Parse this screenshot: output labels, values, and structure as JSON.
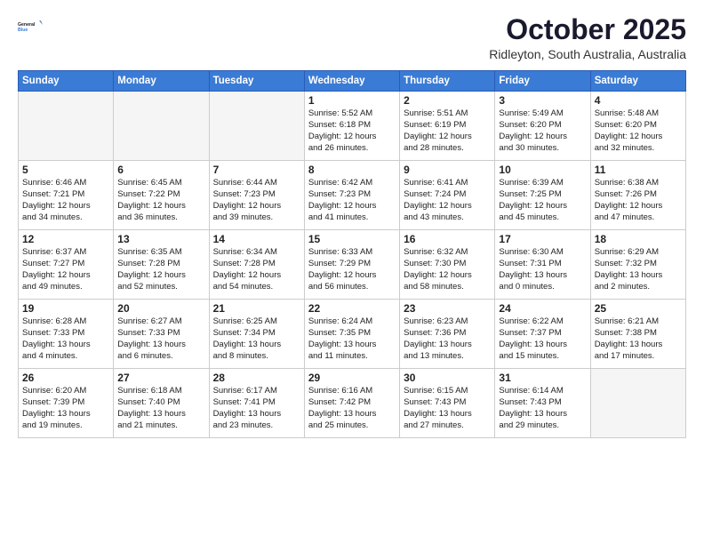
{
  "header": {
    "logo_line1": "General",
    "logo_line2": "Blue",
    "month": "October 2025",
    "location": "Ridleyton, South Australia, Australia"
  },
  "weekdays": [
    "Sunday",
    "Monday",
    "Tuesday",
    "Wednesday",
    "Thursday",
    "Friday",
    "Saturday"
  ],
  "weeks": [
    [
      {
        "day": "",
        "info": ""
      },
      {
        "day": "",
        "info": ""
      },
      {
        "day": "",
        "info": ""
      },
      {
        "day": "1",
        "info": "Sunrise: 5:52 AM\nSunset: 6:18 PM\nDaylight: 12 hours\nand 26 minutes."
      },
      {
        "day": "2",
        "info": "Sunrise: 5:51 AM\nSunset: 6:19 PM\nDaylight: 12 hours\nand 28 minutes."
      },
      {
        "day": "3",
        "info": "Sunrise: 5:49 AM\nSunset: 6:20 PM\nDaylight: 12 hours\nand 30 minutes."
      },
      {
        "day": "4",
        "info": "Sunrise: 5:48 AM\nSunset: 6:20 PM\nDaylight: 12 hours\nand 32 minutes."
      }
    ],
    [
      {
        "day": "5",
        "info": "Sunrise: 6:46 AM\nSunset: 7:21 PM\nDaylight: 12 hours\nand 34 minutes."
      },
      {
        "day": "6",
        "info": "Sunrise: 6:45 AM\nSunset: 7:22 PM\nDaylight: 12 hours\nand 36 minutes."
      },
      {
        "day": "7",
        "info": "Sunrise: 6:44 AM\nSunset: 7:23 PM\nDaylight: 12 hours\nand 39 minutes."
      },
      {
        "day": "8",
        "info": "Sunrise: 6:42 AM\nSunset: 7:23 PM\nDaylight: 12 hours\nand 41 minutes."
      },
      {
        "day": "9",
        "info": "Sunrise: 6:41 AM\nSunset: 7:24 PM\nDaylight: 12 hours\nand 43 minutes."
      },
      {
        "day": "10",
        "info": "Sunrise: 6:39 AM\nSunset: 7:25 PM\nDaylight: 12 hours\nand 45 minutes."
      },
      {
        "day": "11",
        "info": "Sunrise: 6:38 AM\nSunset: 7:26 PM\nDaylight: 12 hours\nand 47 minutes."
      }
    ],
    [
      {
        "day": "12",
        "info": "Sunrise: 6:37 AM\nSunset: 7:27 PM\nDaylight: 12 hours\nand 49 minutes."
      },
      {
        "day": "13",
        "info": "Sunrise: 6:35 AM\nSunset: 7:28 PM\nDaylight: 12 hours\nand 52 minutes."
      },
      {
        "day": "14",
        "info": "Sunrise: 6:34 AM\nSunset: 7:28 PM\nDaylight: 12 hours\nand 54 minutes."
      },
      {
        "day": "15",
        "info": "Sunrise: 6:33 AM\nSunset: 7:29 PM\nDaylight: 12 hours\nand 56 minutes."
      },
      {
        "day": "16",
        "info": "Sunrise: 6:32 AM\nSunset: 7:30 PM\nDaylight: 12 hours\nand 58 minutes."
      },
      {
        "day": "17",
        "info": "Sunrise: 6:30 AM\nSunset: 7:31 PM\nDaylight: 13 hours\nand 0 minutes."
      },
      {
        "day": "18",
        "info": "Sunrise: 6:29 AM\nSunset: 7:32 PM\nDaylight: 13 hours\nand 2 minutes."
      }
    ],
    [
      {
        "day": "19",
        "info": "Sunrise: 6:28 AM\nSunset: 7:33 PM\nDaylight: 13 hours\nand 4 minutes."
      },
      {
        "day": "20",
        "info": "Sunrise: 6:27 AM\nSunset: 7:33 PM\nDaylight: 13 hours\nand 6 minutes."
      },
      {
        "day": "21",
        "info": "Sunrise: 6:25 AM\nSunset: 7:34 PM\nDaylight: 13 hours\nand 8 minutes."
      },
      {
        "day": "22",
        "info": "Sunrise: 6:24 AM\nSunset: 7:35 PM\nDaylight: 13 hours\nand 11 minutes."
      },
      {
        "day": "23",
        "info": "Sunrise: 6:23 AM\nSunset: 7:36 PM\nDaylight: 13 hours\nand 13 minutes."
      },
      {
        "day": "24",
        "info": "Sunrise: 6:22 AM\nSunset: 7:37 PM\nDaylight: 13 hours\nand 15 minutes."
      },
      {
        "day": "25",
        "info": "Sunrise: 6:21 AM\nSunset: 7:38 PM\nDaylight: 13 hours\nand 17 minutes."
      }
    ],
    [
      {
        "day": "26",
        "info": "Sunrise: 6:20 AM\nSunset: 7:39 PM\nDaylight: 13 hours\nand 19 minutes."
      },
      {
        "day": "27",
        "info": "Sunrise: 6:18 AM\nSunset: 7:40 PM\nDaylight: 13 hours\nand 21 minutes."
      },
      {
        "day": "28",
        "info": "Sunrise: 6:17 AM\nSunset: 7:41 PM\nDaylight: 13 hours\nand 23 minutes."
      },
      {
        "day": "29",
        "info": "Sunrise: 6:16 AM\nSunset: 7:42 PM\nDaylight: 13 hours\nand 25 minutes."
      },
      {
        "day": "30",
        "info": "Sunrise: 6:15 AM\nSunset: 7:43 PM\nDaylight: 13 hours\nand 27 minutes."
      },
      {
        "day": "31",
        "info": "Sunrise: 6:14 AM\nSunset: 7:43 PM\nDaylight: 13 hours\nand 29 minutes."
      },
      {
        "day": "",
        "info": ""
      }
    ]
  ]
}
